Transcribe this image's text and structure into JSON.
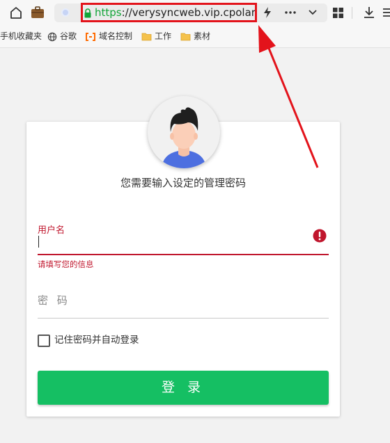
{
  "browser": {
    "url_scheme": "https",
    "url_rest": "://verysyncweb.vip.cpolar.cn/#",
    "bookmarks": [
      {
        "label": "手机收藏夹",
        "icon": "none"
      },
      {
        "label": "谷歌",
        "icon": "globe-icon"
      },
      {
        "label": "域名控制",
        "icon": "bracket-logo-icon"
      },
      {
        "label": "工作",
        "icon": "folder-icon"
      },
      {
        "label": "素材",
        "icon": "folder-icon"
      }
    ],
    "highlight_color": "#e3131b"
  },
  "login": {
    "heading": "您需要输入设定的管理密码",
    "username_label": "用户名",
    "username_value": "",
    "username_error": "请填写您的信息",
    "password_placeholder": "密 码",
    "remember_label": "记住密码并自动登录",
    "remember_checked": false,
    "login_button": "登 录",
    "accent_color": "#15bf63",
    "error_color": "#c0162d"
  }
}
